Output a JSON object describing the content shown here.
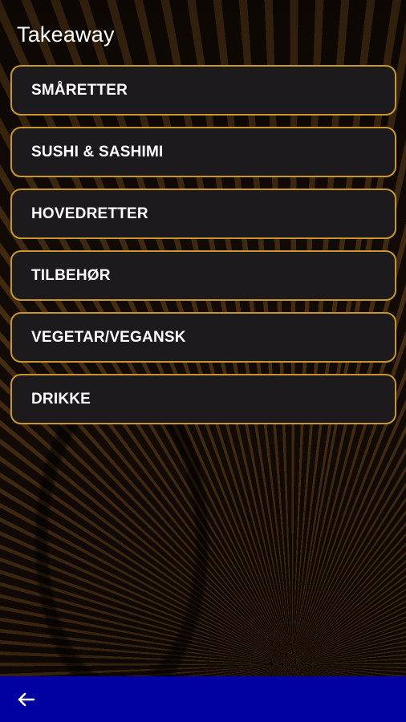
{
  "header": {
    "title": "Takeaway"
  },
  "menu": {
    "items": [
      {
        "label": "SMÅRETTER"
      },
      {
        "label": "SUSHI & SASHIMI"
      },
      {
        "label": "HOVEDRETTER"
      },
      {
        "label": "TILBEHØR"
      },
      {
        "label": "VEGETAR/VEGANSK"
      },
      {
        "label": "DRIKKE"
      }
    ]
  },
  "bottom_bar": {
    "back_icon": "arrow-left-icon",
    "color": "#0000a0"
  },
  "colors": {
    "item_border": "#c8962e",
    "item_background": "#1c1a1d",
    "text": "#ffffff"
  }
}
